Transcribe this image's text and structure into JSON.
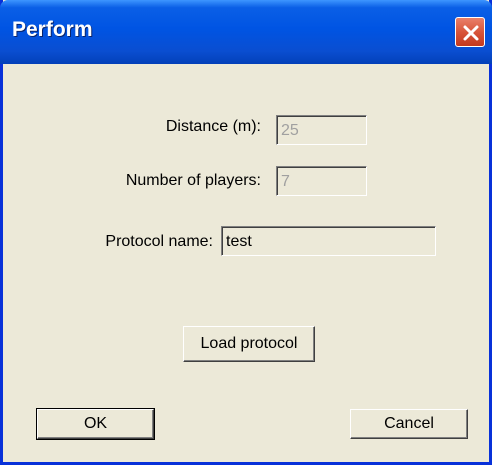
{
  "window": {
    "title": "Perform"
  },
  "form": {
    "distance_label": "Distance (m):",
    "distance_value": "25",
    "players_label": "Number of players:",
    "players_value": "7",
    "protocol_label": "Protocol name:",
    "protocol_value": "test"
  },
  "buttons": {
    "load_label": "Load protocol",
    "ok_label": "OK",
    "cancel_label": "Cancel"
  },
  "colors": {
    "titlebar": "#0054e3",
    "dialog_bg": "#ece9d8",
    "close_button": "#d8553a"
  }
}
